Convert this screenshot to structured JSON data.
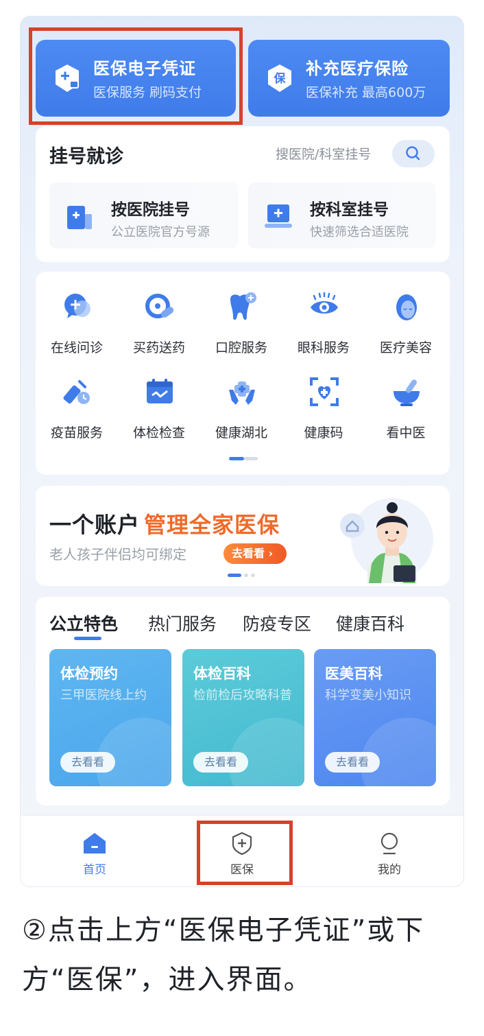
{
  "top_cards": [
    {
      "title": "医保电子凭证",
      "subtitle": "医保服务 刷码支付",
      "icon": "medical-shield-icon"
    },
    {
      "title": "补充医疗保险",
      "subtitle": "医保补充 最高600万",
      "icon": "insurance-badge-icon"
    }
  ],
  "registration": {
    "title": "挂号就诊",
    "search_text": "搜医院/科室挂号",
    "options": [
      {
        "title": "按医院挂号",
        "subtitle": "公立医院官方号源"
      },
      {
        "title": "按科室挂号",
        "subtitle": "快速筛选合适医院"
      }
    ]
  },
  "services": [
    {
      "label": "在线问诊",
      "icon": "chat-doctor-icon"
    },
    {
      "label": "买药送药",
      "icon": "pill-icon"
    },
    {
      "label": "口腔服务",
      "icon": "tooth-icon"
    },
    {
      "label": "眼科服务",
      "icon": "eye-icon"
    },
    {
      "label": "医疗美容",
      "icon": "face-icon"
    },
    {
      "label": "疫苗服务",
      "icon": "vaccine-icon"
    },
    {
      "label": "体检检查",
      "icon": "calendar-check-icon"
    },
    {
      "label": "健康湖北",
      "icon": "hands-heart-icon"
    },
    {
      "label": "健康码",
      "icon": "scan-heart-icon"
    },
    {
      "label": "看中医",
      "icon": "mortar-icon"
    }
  ],
  "banner": {
    "title_plain": "一个账户",
    "title_highlight": "管理全家医保",
    "subtitle": "老人孩子伴侣均可绑定",
    "button": "去看看"
  },
  "feature_tabs": [
    "公立特色",
    "热门服务",
    "防疫专区",
    "健康百科"
  ],
  "feature_cards": [
    {
      "title": "体检预约",
      "subtitle": "三甲医院线上约",
      "button": "去看看"
    },
    {
      "title": "体检百科",
      "subtitle": "检前检后攻略科普",
      "button": "去看看"
    },
    {
      "title": "医美百科",
      "subtitle": "科学变美小知识",
      "button": "去看看"
    }
  ],
  "nav": [
    {
      "label": "首页",
      "icon": "home-icon"
    },
    {
      "label": "医保",
      "icon": "shield-plus-icon"
    },
    {
      "label": "我的",
      "icon": "user-icon"
    }
  ],
  "caption": {
    "line1": "②点击上方“医保电子凭证”或下",
    "line2": "方“医保”，进入界面。"
  },
  "colors": {
    "primary": "#3f7cea",
    "highlight": "#ef6a2a",
    "annotation_box": "#d7402d"
  }
}
